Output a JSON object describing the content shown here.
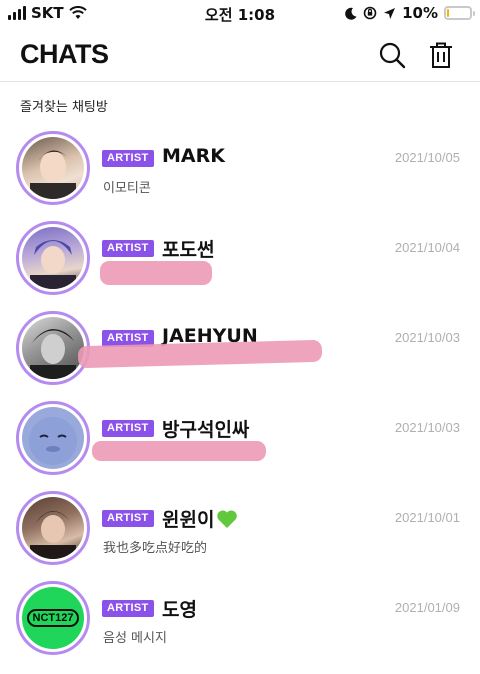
{
  "status_bar": {
    "carrier": "SKT",
    "time": "오전 1:08",
    "battery_percent_text": "10%",
    "battery_level": 0.1,
    "icons": [
      "signal-icon",
      "wifi-icon",
      "moon-icon",
      "orientation-lock-icon",
      "location-arrow-icon",
      "battery-icon"
    ]
  },
  "header": {
    "title": "CHATS",
    "search_icon": "search-icon",
    "trash_icon": "trash-icon"
  },
  "section": {
    "title": "즐겨찾는 채팅방"
  },
  "chats": [
    {
      "badge": "ARTIST",
      "name": "MARK",
      "date": "2021/10/05",
      "preview": "이모티콘"
    },
    {
      "badge": "ARTIST",
      "name": "포도썬",
      "date": "2021/10/04",
      "preview": ""
    },
    {
      "badge": "ARTIST",
      "name": "JAEHYUN",
      "date": "2021/10/03",
      "preview": ""
    },
    {
      "badge": "ARTIST",
      "name": "방구석인싸",
      "date": "2021/10/03",
      "preview": ""
    },
    {
      "badge": "ARTIST",
      "name": "윈윈이",
      "date": "2021/10/01",
      "preview": "我也多吃点好吃的"
    },
    {
      "badge": "ARTIST",
      "name": "도영",
      "date": "2021/01/09",
      "preview": "음성 메시지"
    }
  ],
  "avatar_logo_text": "NCT127",
  "colors": {
    "accent": "#8a52e8",
    "avatar_ring": "#b58bf0",
    "date": "#b0b0b0",
    "redaction": "#ec9ab5",
    "logo_green": "#1fd65a",
    "battery": "#f4b400"
  }
}
